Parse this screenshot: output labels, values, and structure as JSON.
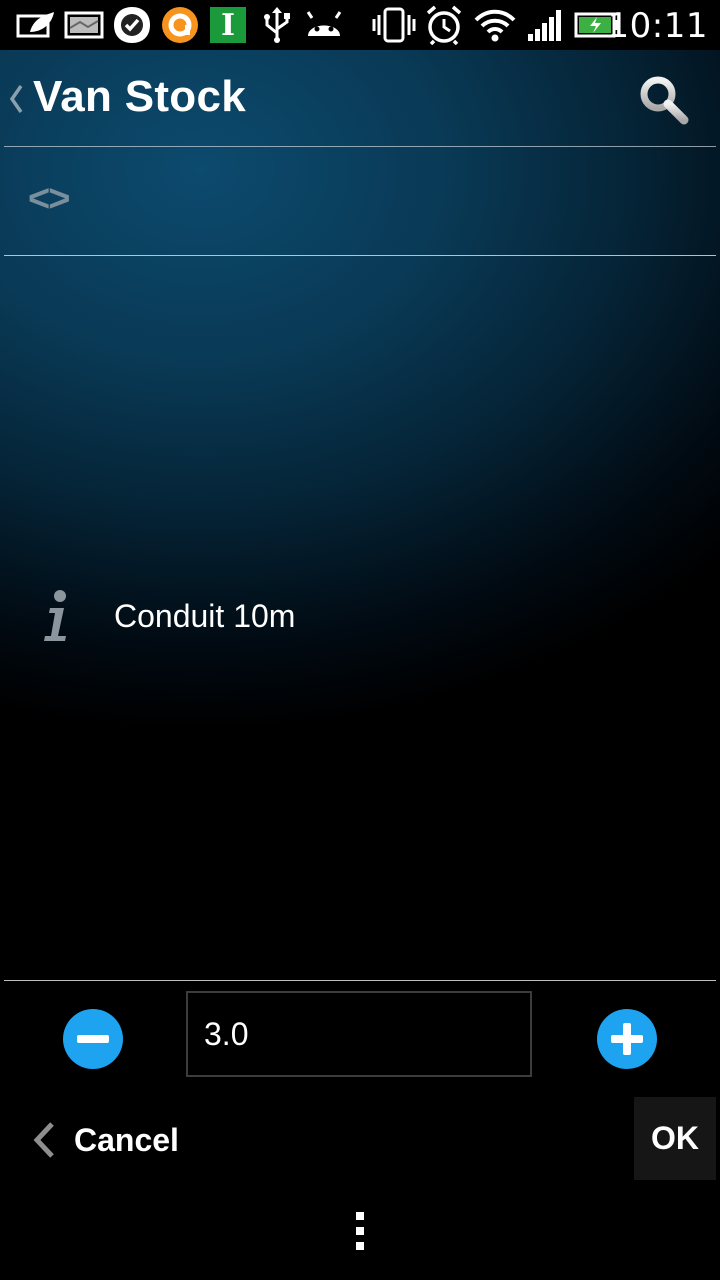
{
  "status_bar": {
    "time": "10:11",
    "icons": [
      "leaf-message-icon",
      "image-notification-icon",
      "check-badge-icon",
      "orange-app-icon",
      "instapaper-icon",
      "usb-icon",
      "android-debug-icon",
      "vibrate-icon",
      "alarm-icon",
      "wifi-icon",
      "signal-icon",
      "battery-charging-icon"
    ],
    "instapaper_letter": "I"
  },
  "action_bar": {
    "title": "Van Stock",
    "search_icon": "search-icon"
  },
  "nav": {
    "arrows": "<>"
  },
  "item": {
    "name": "Conduit 10m",
    "icon": "info-icon"
  },
  "stepper": {
    "value": "3.0"
  },
  "buttons": {
    "cancel": "Cancel",
    "ok": "OK"
  },
  "colors": {
    "accent": "#1ea3f0",
    "header_gradient": "#0c4a6e"
  }
}
